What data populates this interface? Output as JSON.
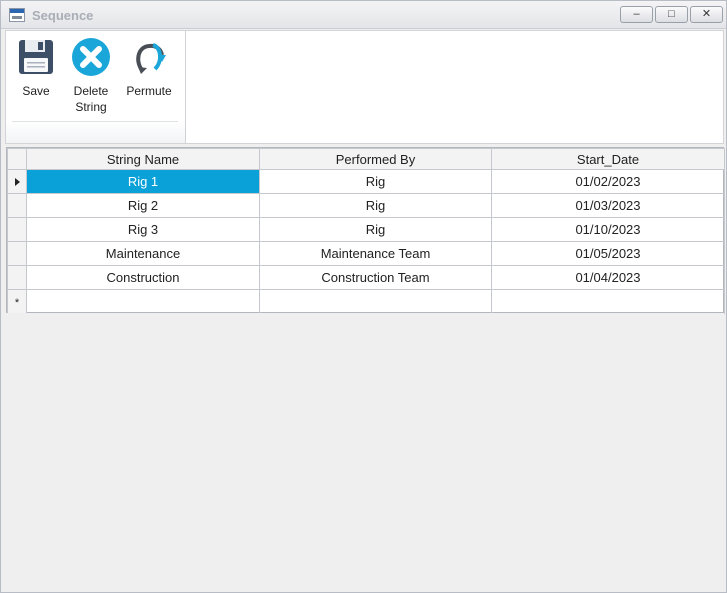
{
  "window": {
    "title": "Sequence",
    "controls": {
      "minimize": "–",
      "maximize": "□",
      "close": "✕"
    }
  },
  "ribbon": {
    "buttons": [
      {
        "label": "Save",
        "icon": "floppy-disk-icon"
      },
      {
        "label": "Delete String",
        "icon": "delete-x-icon"
      },
      {
        "label": "Permute",
        "icon": "permute-arrows-icon"
      }
    ]
  },
  "grid": {
    "columns": [
      "String Name",
      "Performed By",
      "Start_Date"
    ],
    "rows": [
      {
        "string_name": "Rig 1",
        "performed_by": "Rig",
        "start_date": "01/02/2023",
        "selected": true
      },
      {
        "string_name": "Rig 2",
        "performed_by": "Rig",
        "start_date": "01/03/2023"
      },
      {
        "string_name": "Rig 3",
        "performed_by": "Rig",
        "start_date": "01/10/2023"
      },
      {
        "string_name": "Maintenance",
        "performed_by": "Maintenance Team",
        "start_date": "01/05/2023"
      },
      {
        "string_name": "Construction",
        "performed_by": "Construction Team",
        "start_date": "01/04/2023"
      }
    ],
    "new_row_marker": "*",
    "selection_color": "#0aa1d9"
  }
}
